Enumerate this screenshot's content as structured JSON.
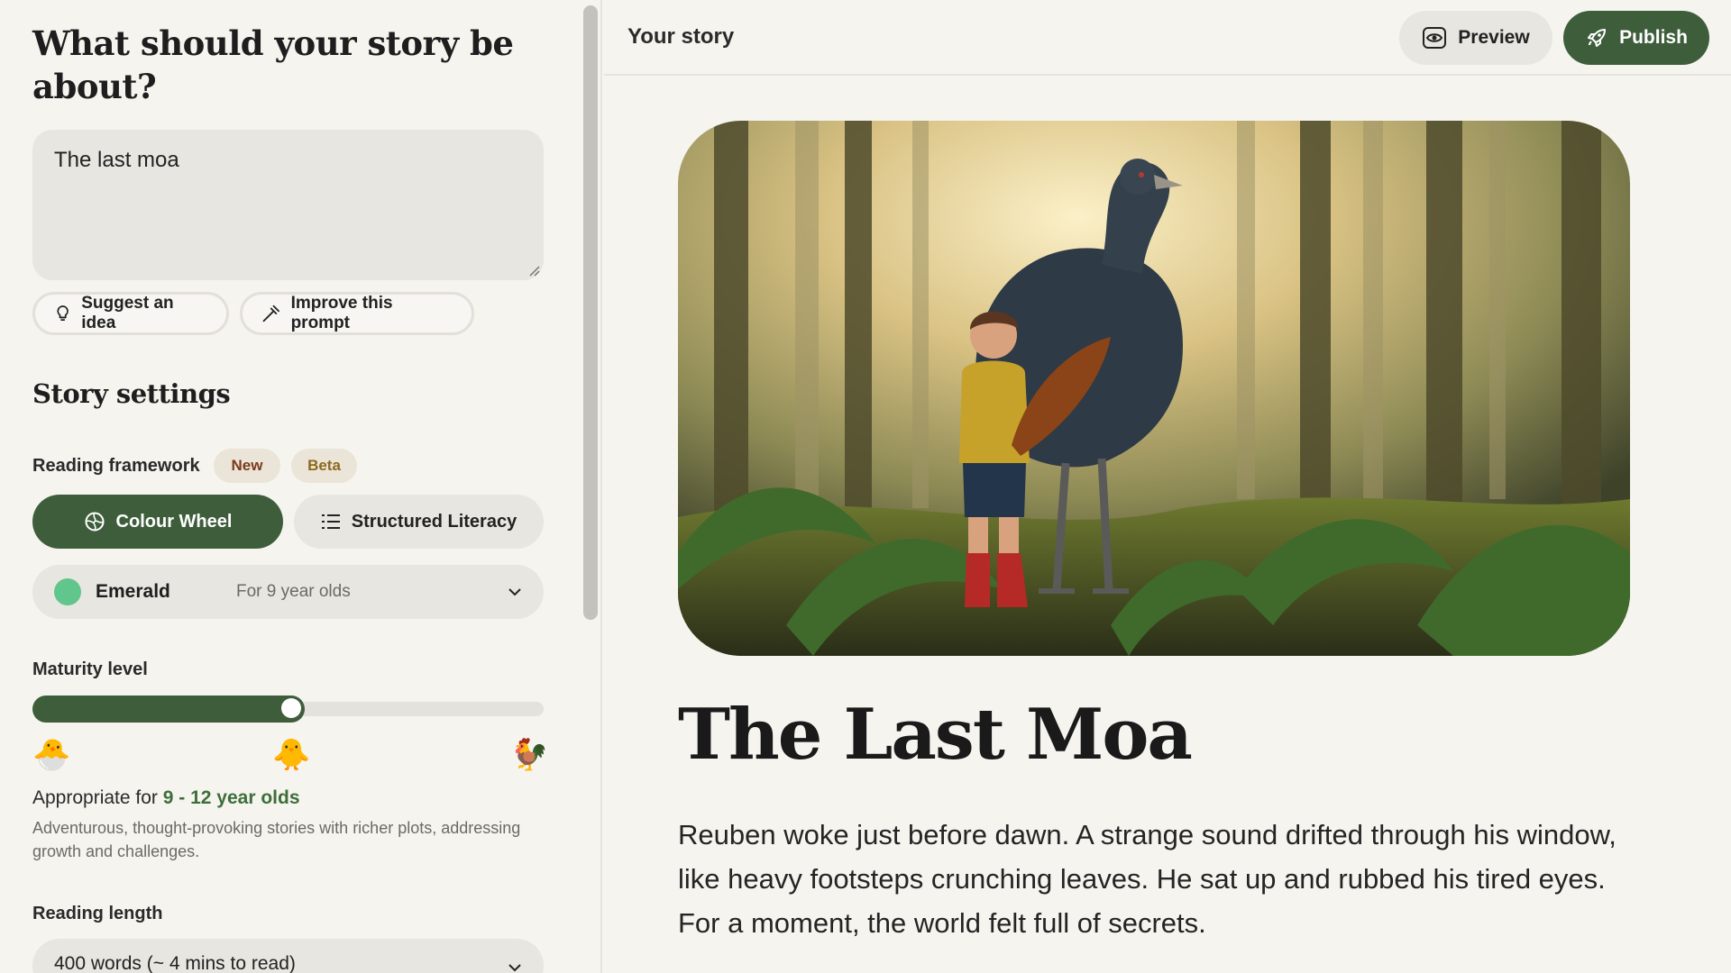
{
  "sidebar": {
    "heading": "What should your story be about?",
    "prompt_value": "The last moa",
    "suggest_label": "Suggest an idea",
    "improve_label": "Improve this prompt",
    "settings_heading": "Story settings",
    "framework_label": "Reading framework",
    "badge_new": "New",
    "badge_beta": "Beta",
    "framework_options": [
      "Colour Wheel",
      "Structured Literacy"
    ],
    "framework_selected": "Colour Wheel",
    "level": {
      "name": "Emerald",
      "age": "For 9 year olds",
      "color": "#61c68b"
    },
    "maturity_label": "Maturity level",
    "maturity_value": 0.5,
    "maturity_emojis": [
      "🐣",
      "🐥",
      "🐓"
    ],
    "appropriate_prefix": "Appropriate for",
    "appropriate_range": "9 - 12 year olds",
    "maturity_description": "Adventurous, thought-provoking stories with richer plots, addressing growth and challenges.",
    "length_label": "Reading length",
    "length_value": "400 words (~ 4 mins to read)"
  },
  "topbar": {
    "title": "Your story",
    "preview_label": "Preview",
    "publish_label": "Publish"
  },
  "story": {
    "title": "The Last Moa",
    "paragraph": "Reuben woke just before dawn. A strange sound drifted through his window, like heavy footsteps crunching leaves. He sat up and rubbed his tired eyes. For a moment, the world felt full of secrets."
  },
  "colors": {
    "accent": "#3e5e3b",
    "background": "#f5f4ef",
    "surface": "#e7e6e0"
  },
  "icons": [
    "lightbulb-icon",
    "wand-icon",
    "colour-wheel-icon",
    "list-icon",
    "chevron-down-icon",
    "eye-icon",
    "rocket-icon"
  ]
}
